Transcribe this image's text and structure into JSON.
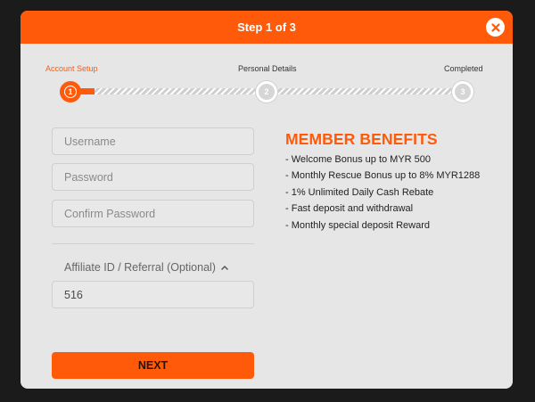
{
  "header": {
    "title": "Step 1 of 3"
  },
  "steps": [
    {
      "label": "Account Setup",
      "number": "1"
    },
    {
      "label": "Personal Details",
      "number": "2"
    },
    {
      "label": "Completed",
      "number": "3"
    }
  ],
  "form": {
    "username_placeholder": "Username",
    "password_placeholder": "Password",
    "confirm_password_placeholder": "Confirm Password",
    "affiliate_toggle_label": "Affiliate ID / Referral (Optional)",
    "affiliate_value": "516",
    "next_label": "NEXT"
  },
  "benefits": {
    "title": "MEMBER BENEFITS",
    "items": [
      "- Welcome Bonus up to MYR 500",
      "- Monthly Rescue Bonus up to 8% MYR1288",
      "- 1% Unlimited Daily Cash Rebate",
      "- Fast deposit and withdrawal",
      "- Monthly special deposit Reward"
    ]
  },
  "colors": {
    "accent": "#ff5a09",
    "modal_bg": "#e6e6e6",
    "page_bg": "#1b1b1b"
  },
  "icons": {
    "close": "close-icon",
    "affiliate_toggle": "chevron-up-icon"
  }
}
